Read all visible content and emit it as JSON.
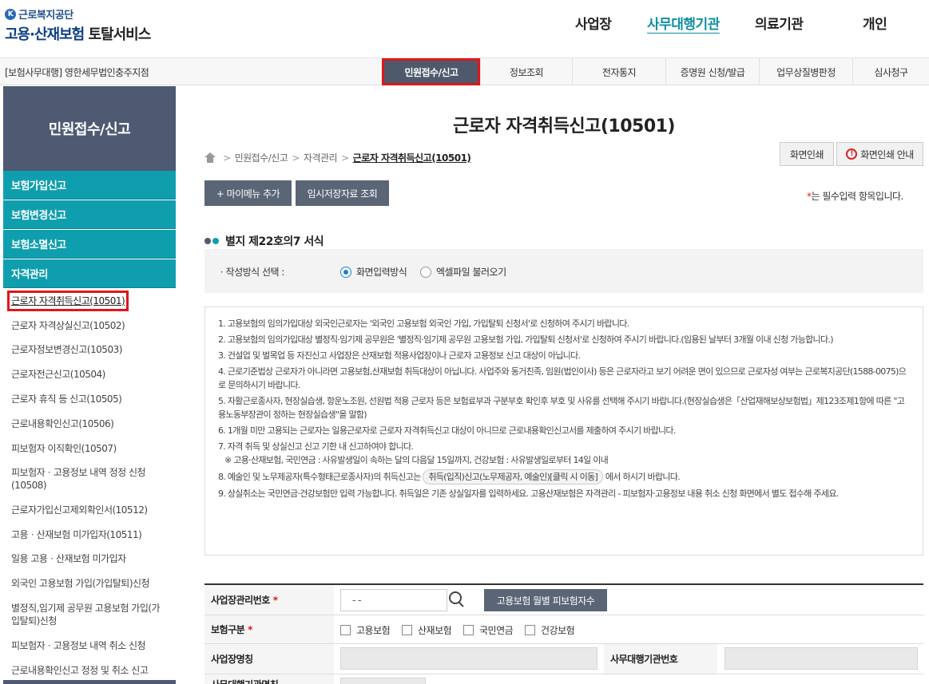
{
  "header": {
    "org_name": "근로복지공단",
    "service_name_blue": "고용·산재보험",
    "service_name_dark": "토탈서비스",
    "gnb": [
      "사업장",
      "사무대행기관",
      "의료기관",
      "개인"
    ]
  },
  "subbar": {
    "agency": "[보험사무대행] 영한세무법인충주지점",
    "menus": [
      "민원접수/신고",
      "정보조회",
      "전자통지",
      "증명원 신청/발급",
      "업무상질병판정",
      "심사청구"
    ]
  },
  "sidebar": {
    "title": "민원접수/신고",
    "categories": [
      "보험가입신고",
      "보험변경신고",
      "보험소멸신고",
      "자격관리"
    ],
    "items": [
      "근로자 자격취득신고(10501)",
      "근로자 자격상실신고(10502)",
      "근로자정보변경신고(10503)",
      "근로자전근신고(10504)",
      "근로자 휴직 등 신고(10505)",
      "근로내용확인신고(10506)",
      "피보험자 이직확인(10507)",
      "피보험자ㆍ고용정보 내역 정정 신청(10508)",
      "근로자가입신고제외확인서(10512)",
      "고용ㆍ산재보험 미가입자(10511)",
      "일용 고용ㆍ산재보험 미가입자",
      "외국인 고용보험 가입(가입탈퇴)신청",
      "별정직,임기제 공무원 고용보험 가입(가입탈퇴)신청",
      "피보험자ㆍ고용정보 내역 취소 신청",
      "근로내용확인신고 정정 및 취소 신고"
    ]
  },
  "main": {
    "title": "근로자 자격취득신고(10501)",
    "breadcrumb": [
      "민원접수/신고",
      "자격관리",
      "근로자 자격취득신고(10501)"
    ],
    "print_label": "화면인쇄",
    "print_guide_label": "화면인쇄 안내",
    "mymenu_label": "+ 마이메뉴 추가",
    "temp_saved_label": "임시저장자료 조회",
    "required_note": "는 필수입력 항목입니다.",
    "required_star": "*",
    "section_title": "별지 제22호의7 서식",
    "write_method_label": "ㆍ작성방식 선택 :",
    "write_method_options": [
      "화면입력방식",
      "엑셀파일 불러오기"
    ],
    "write_method_selected": "화면입력방식",
    "notices": [
      "1. 고용보험의 임의가입대상 외국인근로자는 '외국인 고용보험 외국인 가입, 가입탈퇴 신청서'로 신청하여 주시기 바랍니다.",
      "2. 고용보험의 임의가입대상 별정직·임기제 공무원은 '별정직·임기제 공무원 고용보험 가입, 가입탈퇴 신청서'로 신청하여 주시기 바랍니다.(임용된 날부터 3개월 이내 신청 가능합니다.)",
      "3. 건설업 및 벌목업 등 자진신고 사업장은 산재보험 적용사업장이나 근로자 고용정보 신고 대상이 아닙니다.",
      "4. 근로기준법상 근로자가 아니라면 고용보험,산재보험 취득대상이 아닙니다. 사업주와 동거친족, 임원(법인이사) 등은 근로자라고 보기 어려운 면이 있으므로 근로자성 여부는 근로복지공단(1588-0075)으로 문의하시기 바랍니다.",
      "5. 자활근로종사자, 현장실습생, 항운노조원, 선원법 적용 근로자 등은 보험료부과 구분부호 확인후 부호 및 사유를 선택해 주시기 바랍니다.(현장실습생은「산업재해보상보험법」제123조제1항에 따른 \"고용노동부장관이 정하는 현장실습생\"을 말함)",
      "6. 1개월 미만 고용되는 근로자는 일용근로자로 근로자 자격취득신고 대상이 아니므로 근로내용확인신고서를 제출하여 주시기 바랍니다.",
      "7. 자격 취득 및 상실신고 신고 기한 내 신고하여야 합니다.",
      "※ 고용·산재보험, 국민연금 : 사유발생일이 속하는 달의 다음달 15일까지, 건강보험 : 사유발생일로부터 14일 이내",
      "8. 예술인 및 노무제공자(특수형태근로종사자)의 취득신고는",
      "9. 상실취소는 국민연금·건강보험만 입력 가능합니다. 취득일은 기존 상실일자를 입력하세요. 고용산재보험은 자격관리 - 피보험자·고용정보 내용 취소 신청 화면에서 별도 접수해 주세요."
    ],
    "notice8_link": "취득(입직)신고(노무제공자, 예술인)[클릭 시 이동]",
    "notice8_tail": "에서 하시기 바랍니다."
  },
  "form": {
    "biz_no_label": "사업장관리번호",
    "biz_no_value": "-   -",
    "monthly_btn": "고용보험 월별 피보험자수",
    "insurance_type_label": "보험구분",
    "insurance_types": [
      "고용보험",
      "산재보험",
      "국민연금",
      "건강보험"
    ],
    "biz_name_label": "사업장명칭",
    "agency_no_label": "사무대행기관번호",
    "agency_name_label": "사무대행기관명칭"
  },
  "colors": {
    "teal": "#0f9eae",
    "nav_dark": "#4e5a72",
    "highlight_red": "#e0161b"
  }
}
